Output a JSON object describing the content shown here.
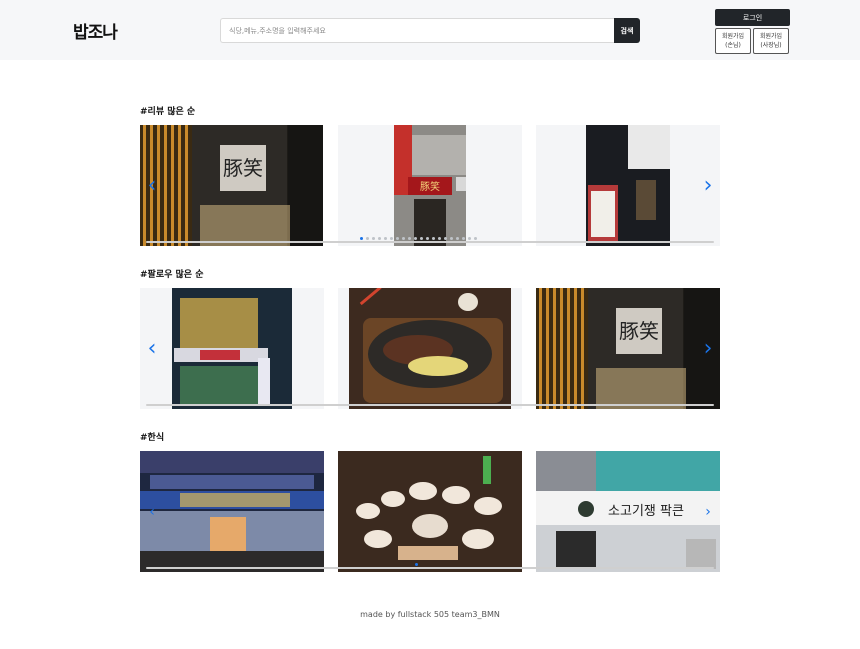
{
  "header": {
    "logo": "밥조나",
    "search_placeholder": "식당,메뉴,주소명을 입력해주세요",
    "search_button": "검색",
    "login_button": "로그인",
    "join_user": {
      "line1": "회원가입",
      "line2": "(손님)"
    },
    "join_owner": {
      "line1": "회원가입",
      "line2": "(사장님)"
    }
  },
  "sections": [
    {
      "title": "#리뷰 많은 순"
    },
    {
      "title": "#팔로우 많은 순"
    },
    {
      "title": "#한식"
    }
  ],
  "colors": {
    "accent": "#1a73e8",
    "dark_button": "#212529",
    "header_bg": "#f6f7f9"
  },
  "icons": {
    "prev": "chevron-left-icon",
    "next": "chevron-right-icon"
  },
  "footer": "made by fullstack 505 team3_BMN"
}
